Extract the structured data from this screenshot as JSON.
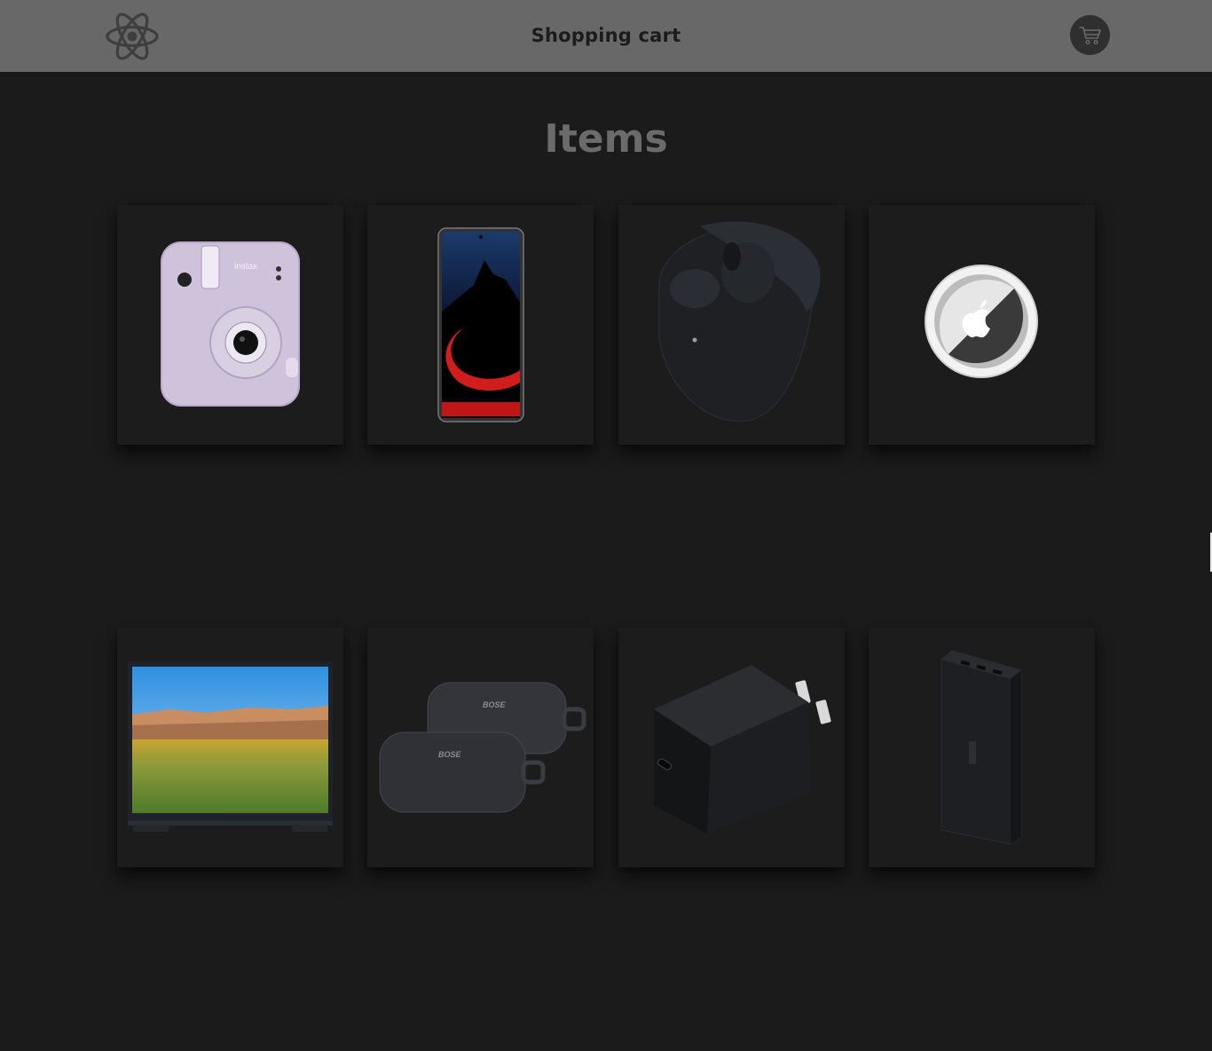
{
  "header": {
    "title": "Shopping cart",
    "logo_icon": "atom-logo-icon",
    "cart_icon": "shopping-cart-icon"
  },
  "main": {
    "heading": "Items",
    "products": [
      {
        "image": "instant-camera-image"
      },
      {
        "image": "smartphone-image"
      },
      {
        "image": "wireless-earbuds-image"
      },
      {
        "image": "airtag-image"
      },
      {
        "image": "television-image"
      },
      {
        "image": "bluetooth-speakers-image"
      },
      {
        "image": "usb-c-charger-image"
      },
      {
        "image": "power-bank-image"
      }
    ]
  },
  "colors": {
    "header_bg": "#686868",
    "page_bg": "#1b1b1b",
    "card_bg": "#1c1c1c",
    "heading": "#6b6b6b",
    "title": "#1c1c1c",
    "cart_button_bg": "#2f2f2f"
  }
}
